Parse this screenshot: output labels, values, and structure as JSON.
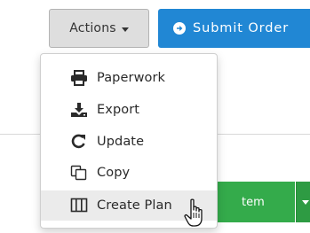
{
  "toolbar": {
    "actions_label": "Actions",
    "submit_label": "Submit Order"
  },
  "background": {
    "green_button_label": "tem"
  },
  "menu": {
    "items": [
      {
        "label": "Paperwork",
        "icon": "print-icon"
      },
      {
        "label": "Export",
        "icon": "download-icon"
      },
      {
        "label": "Update",
        "icon": "refresh-icon"
      },
      {
        "label": "Copy",
        "icon": "copy-icon"
      },
      {
        "label": "Create Plan",
        "icon": "columns-icon"
      }
    ],
    "hovered_index": 4
  },
  "colors": {
    "primary_blue": "#2187d4",
    "success_green": "#34ab4b",
    "default_button_bg": "#dedede",
    "menu_hover_bg": "#ebebeb"
  },
  "cursor": {
    "type": "pointer-hand-icon"
  }
}
